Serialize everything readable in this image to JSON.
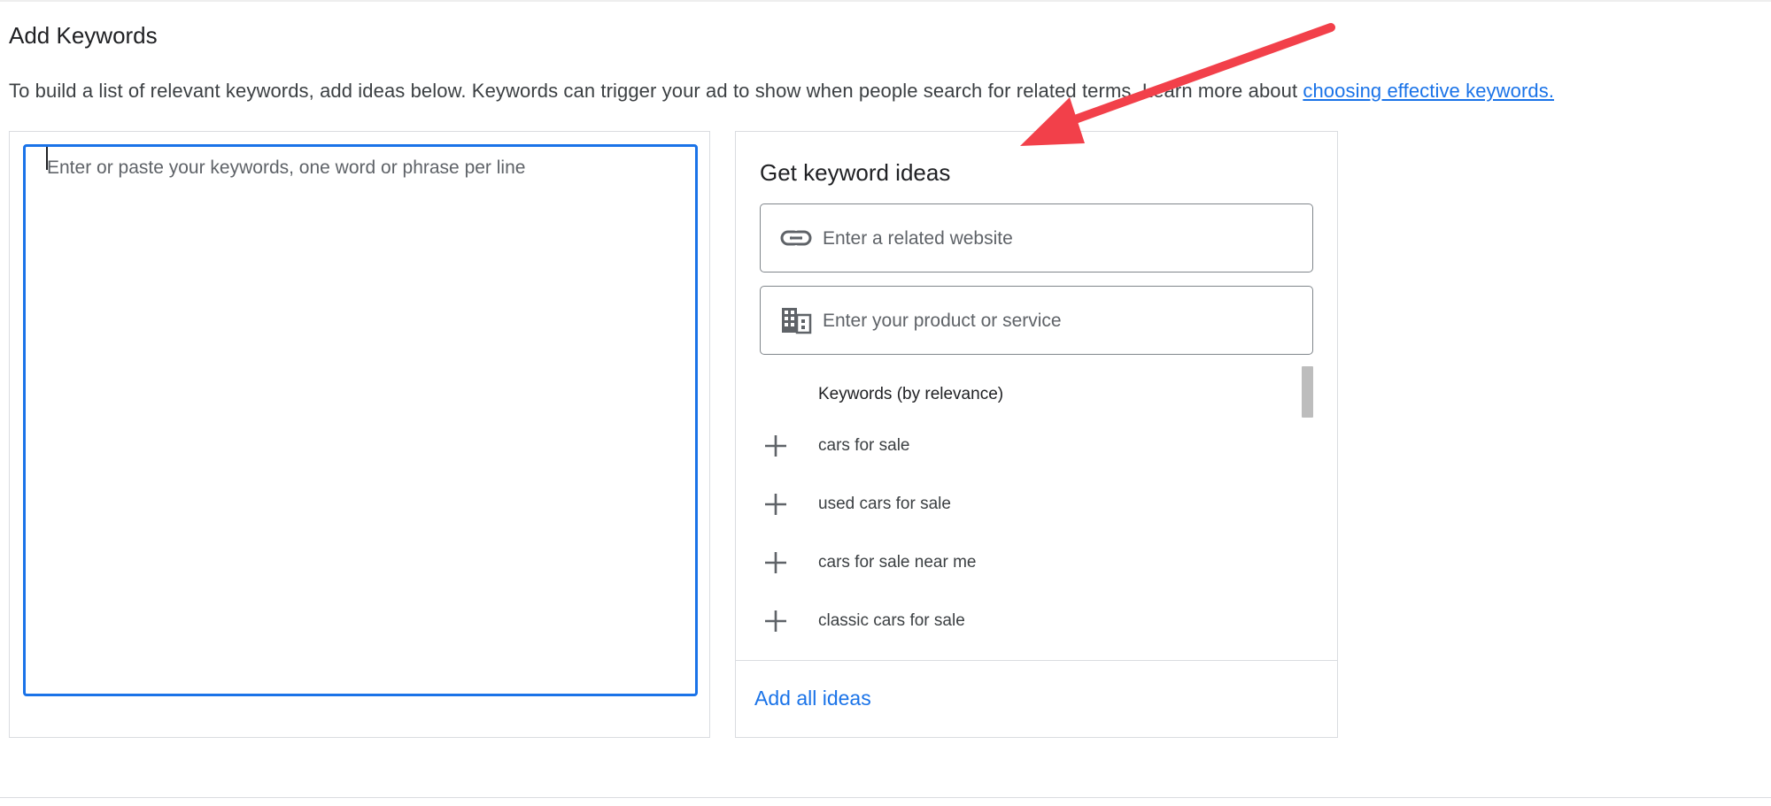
{
  "header": {
    "title": "Add Keywords",
    "intro_text": "To build a list of relevant keywords, add ideas below. Keywords can trigger your ad to show when people search for related terms. Learn more about ",
    "intro_link": "choosing effective keywords."
  },
  "keywords_input": {
    "placeholder": "Enter or paste your keywords, one word or phrase per line",
    "value": ""
  },
  "ideas": {
    "title": "Get keyword ideas",
    "website_placeholder": "Enter a related website",
    "product_placeholder": "Enter your product or service",
    "list_header": "Keywords (by relevance)",
    "items": [
      {
        "label": "cars for sale"
      },
      {
        "label": "used cars for sale"
      },
      {
        "label": "cars for sale near me"
      },
      {
        "label": "classic cars for sale"
      }
    ],
    "add_all_label": "Add all ideas"
  },
  "icons": {
    "website": "link-icon",
    "product": "building-icon",
    "add": "plus-icon"
  },
  "colors": {
    "accent": "#1a73e8",
    "annotation_arrow": "#f2404a"
  }
}
